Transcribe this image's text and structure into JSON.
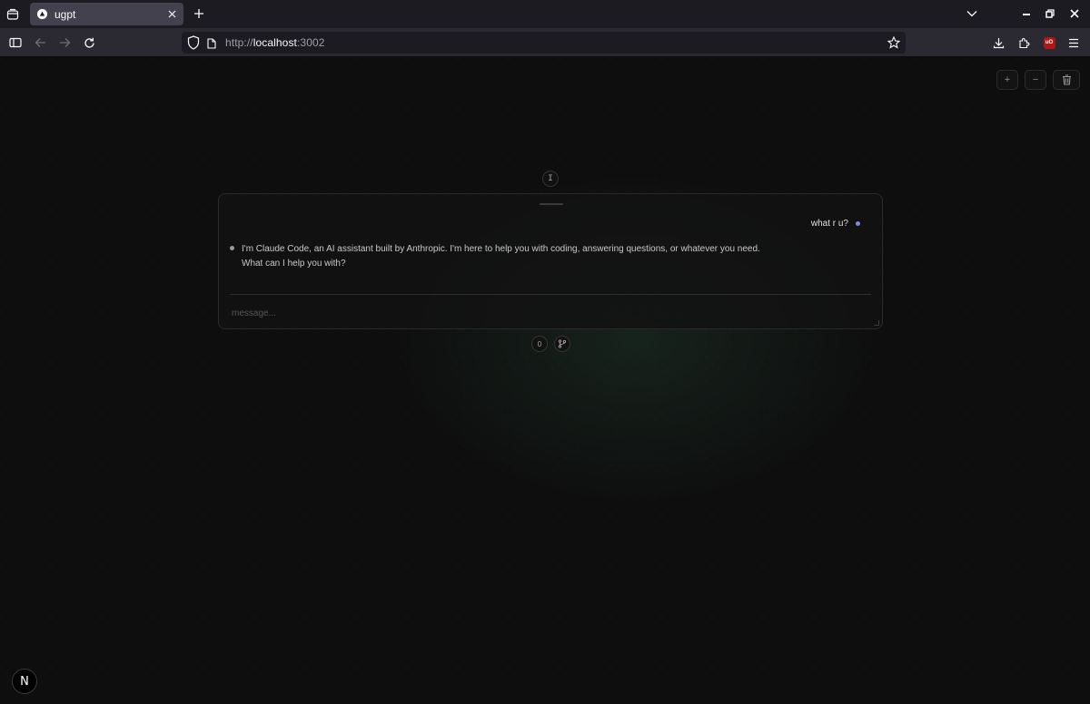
{
  "browser": {
    "tab": {
      "title": "ugpt",
      "favicon": "triangle-icon"
    },
    "url": {
      "scheme": "http://",
      "host": "localhost",
      "port": ":3002"
    },
    "icons": {
      "tab_list": "tab-list-icon",
      "new_tab": "plus-icon",
      "list_all_tabs": "chevron-down-icon",
      "minimize": "minimize-icon",
      "restore": "restore-icon",
      "close": "close-icon",
      "sidebar": "sidebar-icon",
      "back": "back-arrow-icon",
      "forward": "forward-arrow-icon",
      "reload": "reload-icon",
      "tracking_shield": "shield-icon",
      "page_info": "page-icon",
      "bookmark": "star-icon",
      "downloads": "download-icon",
      "extensions": "puzzle-icon",
      "ublock": "ublock-icon",
      "menu": "hamburger-menu-icon"
    },
    "ublock_label": "uO"
  },
  "app": {
    "top_controls": {
      "zoom_in": "+",
      "zoom_out": "−"
    },
    "mode_button": "I",
    "chat": {
      "messages": [
        {
          "role": "user",
          "text": "what r u?"
        },
        {
          "role": "assistant",
          "lines": [
            "I'm Claude Code, an AI assistant built by Anthropic. I'm here to help you with coding, answering questions, or whatever you need.",
            "What can I help you with?"
          ]
        }
      ],
      "input": {
        "placeholder": "message...",
        "value": ""
      }
    },
    "counter": "0",
    "colors": {
      "user_dot": "#7b8cd6",
      "assistant_dot": "#9a9a9a",
      "background": "#0e0e0e"
    },
    "dev_badge": "N"
  }
}
